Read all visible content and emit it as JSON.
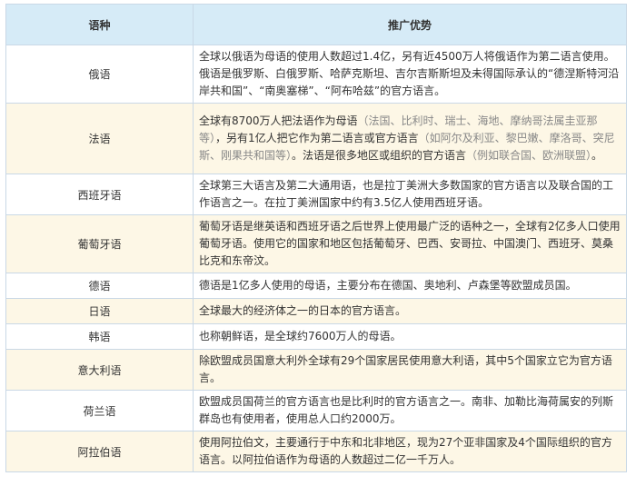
{
  "header": {
    "col1": "语种",
    "col2": "推广优势"
  },
  "rows": [
    {
      "lang": "俄语",
      "desc": "全球以俄语为母语的使用人数超过1.4亿，另有近4500万人将俄语作为第二语言使用。俄语是俄罗斯、白俄罗斯、哈萨克斯坦、吉尔吉斯斯坦及未得国际承认的“德涅斯特河沿岸共和国”、“南奥塞梯”、“阿布哈兹”的官方语言。"
    },
    {
      "lang": "法语",
      "desc_a": "全球有8700万人把法语作为母语",
      "desc_b": "（法国、比利时、瑞士、海地、摩纳哥法属圭亚那等）",
      "desc_c": "，另有1亿人把它作为第二语言或官方语言",
      "desc_d": "（如阿尔及利亚、黎巴嫩、摩洛哥、突尼斯、刚果共和国等）",
      "desc_e": "。法语是很多地区或组织的官方语言",
      "desc_f": "（例如联合国、欧洲联盟）",
      "desc_g": "。"
    },
    {
      "lang": "西班牙语",
      "desc": "全球第三大语言及第二大通用语，也是拉丁美洲大多数国家的官方语言以及联合国的工作语言之一。在拉丁美洲国家中约有3.5亿人使用西班牙语。"
    },
    {
      "lang": "葡萄牙语",
      "desc": "葡萄牙语是继英语和西班牙语之后世界上使用最广泛的语种之一，全球有2亿多人口使用葡萄牙语。使用它的国家和地区包括葡萄牙、巴西、安哥拉、中国澳门、西班牙、莫桑比克和东帝汶。"
    },
    {
      "lang": "德语",
      "desc": "德语是1亿多人使用的母语，主要分布在德国、奥地利、卢森堡等欧盟成员国。"
    },
    {
      "lang": "日语",
      "desc": "全球最大的经济体之一的日本的官方语言。"
    },
    {
      "lang": "韩语",
      "desc": "也称朝鲜语，是全球约7600万人的母语。"
    },
    {
      "lang": "意大利语",
      "desc": "除欧盟成员国意大利外全球有29个国家居民使用意大利语，其中5个国家立它为官方语言。"
    },
    {
      "lang": "荷兰语",
      "desc": "欧盟成员国荷兰的官方语言也是比利时的官方语言之一。南非、加勒比海荷属安的列斯群岛也有使用者，使用总人口约2000万。"
    },
    {
      "lang": "阿拉伯语",
      "desc": "使用阿拉伯文，主要通行于中东和北非地区，现为27个亚非国家及4个国际组织的官方语言。以阿拉伯语作为母语的人数超过二亿一千万人。"
    }
  ]
}
